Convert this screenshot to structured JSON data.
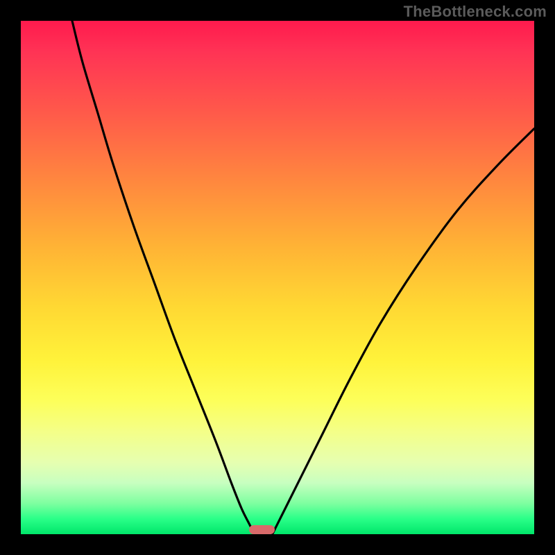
{
  "watermark": {
    "text": "TheBottleneck.com"
  },
  "chart_data": {
    "type": "line",
    "title": "",
    "xlabel": "",
    "ylabel": "",
    "xlim": [
      0,
      100
    ],
    "ylim": [
      0,
      100
    ],
    "grid": false,
    "annotations": [],
    "background_gradient": {
      "orientation": "vertical",
      "stops": [
        {
          "pos": 0.0,
          "color": "#ff1a4d"
        },
        {
          "pos": 0.5,
          "color": "#ffd933"
        },
        {
          "pos": 0.8,
          "color": "#f4ff88"
        },
        {
          "pos": 1.0,
          "color": "#00e66a"
        }
      ]
    },
    "series": [
      {
        "name": "left-branch",
        "x": [
          10,
          12,
          15,
          18,
          22,
          26,
          30,
          34,
          38,
          41,
          43,
          44.5,
          45.5
        ],
        "y": [
          100,
          92,
          82,
          72,
          60,
          49,
          38,
          28,
          18,
          10,
          5,
          2,
          0
        ]
      },
      {
        "name": "right-branch",
        "x": [
          49,
          50,
          52,
          55,
          59,
          64,
          70,
          77,
          85,
          93,
          100
        ],
        "y": [
          0,
          2,
          6,
          12,
          20,
          30,
          41,
          52,
          63,
          72,
          79
        ]
      }
    ],
    "marker": {
      "x_center": 47,
      "y": 0,
      "width": 5,
      "height": 1.8,
      "color": "#d86a6a"
    }
  },
  "colors": {
    "curve_stroke": "#000000",
    "frame_border": "#000000"
  }
}
